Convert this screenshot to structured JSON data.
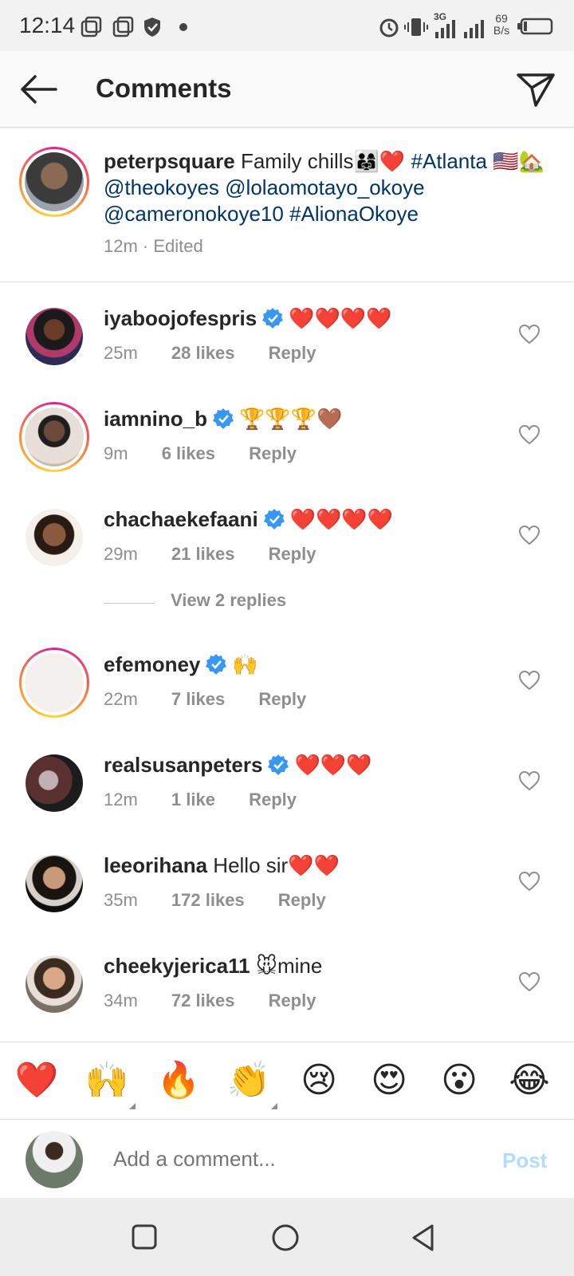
{
  "status_bar": {
    "time": "12:14",
    "network": "3G",
    "speed_value": "69",
    "speed_unit": "B/s"
  },
  "header": {
    "title": "Comments"
  },
  "caption": {
    "username": "peterpsquare",
    "text": "Family chills👨‍👩‍👧❤️",
    "tag_atlanta": "#Atlanta",
    "flags": "🇺🇸🏡",
    "mention1": "@theokoyes",
    "mention2": "@lolaomotayo_okoye",
    "mention3": "@cameronokoye10",
    "tag_aliona": "#AlionaOkoye",
    "meta": "12m · Edited"
  },
  "comments": [
    {
      "username": "iyaboojofespris",
      "verified": true,
      "text": "❤️❤️❤️❤️",
      "time": "25m",
      "likes": "28 likes",
      "reply": "Reply"
    },
    {
      "username": "iamnino_b",
      "verified": true,
      "text": "🏆🏆🏆🤎",
      "time": "9m",
      "likes": "6 likes",
      "reply": "Reply"
    },
    {
      "username": "chachaekefaani",
      "verified": true,
      "text": "❤️❤️❤️❤️",
      "time": "29m",
      "likes": "21 likes",
      "reply": "Reply"
    },
    {
      "username": "efemoney",
      "verified": true,
      "text": "🙌",
      "time": "22m",
      "likes": "7 likes",
      "reply": "Reply"
    },
    {
      "username": "realsusanpeters",
      "verified": true,
      "text": "❤️❤️❤️",
      "time": "12m",
      "likes": "1 like",
      "reply": "Reply"
    },
    {
      "username": "leeorihana",
      "verified": false,
      "text": "Hello sir❤️❤️",
      "time": "35m",
      "likes": "172 likes",
      "reply": "Reply"
    },
    {
      "username": "cheekyjerica11",
      "verified": false,
      "text": "🐭mine",
      "time": "34m",
      "likes": "72 likes",
      "reply": "Reply"
    }
  ],
  "view_replies": "View 2 replies",
  "quick_reactions": [
    "❤️",
    "🙌",
    "🔥",
    "👏",
    "😢",
    "😍",
    "😮",
    "😂"
  ],
  "composer": {
    "placeholder": "Add a comment...",
    "post_label": "Post"
  },
  "colors": {
    "link": "#003569",
    "verified": "#3897f0",
    "post_disabled": "#b3dbff",
    "muted": "#8e8e8e"
  },
  "icons": [
    "back-arrow-icon",
    "send-icon",
    "verified-badge-icon",
    "heart-outline-icon",
    "nav-square-icon",
    "nav-circle-icon",
    "nav-back-triangle-icon"
  ]
}
